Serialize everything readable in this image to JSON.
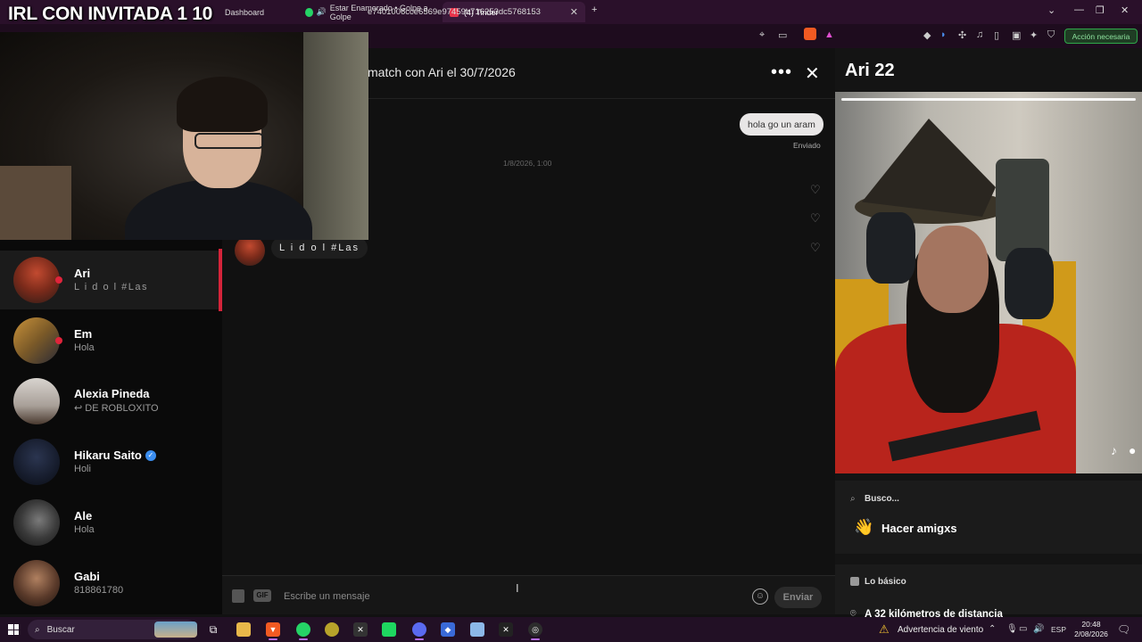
{
  "stream": {
    "title": "IRL CON INVITADA 1 10"
  },
  "browser": {
    "tabs": [
      {
        "label": "Dashboard",
        "active": false
      },
      {
        "label": "Estar Enamorado • Golpe a Golpe",
        "active": false
      },
      {
        "label": "(4) Tinder",
        "active": true
      }
    ],
    "new_tab": "+",
    "url": "e7401006cce6569e97459b716253dc5768153",
    "action_button": "Acción necesaria",
    "window_controls": [
      "⌄",
      "—",
      "❐",
      "✕"
    ]
  },
  "sidebar": {
    "matches": [
      {
        "name": "Ari",
        "message": "L i d o l #Las",
        "online": true,
        "verified": false,
        "active": true
      },
      {
        "name": "Em",
        "message": "Hola",
        "online": true,
        "verified": false,
        "active": false
      },
      {
        "name": "Alexia Pineda",
        "message": "↩ DE ROBLOXITO",
        "online": false,
        "verified": false,
        "active": false
      },
      {
        "name": "Hikaru Saito",
        "message": "Holi",
        "online": false,
        "verified": true,
        "active": false
      },
      {
        "name": "Ale",
        "message": "Hola",
        "online": false,
        "verified": false,
        "active": false
      },
      {
        "name": "Gabi",
        "message": "818861780",
        "online": false,
        "verified": false,
        "active": false
      }
    ]
  },
  "chat": {
    "header": "match con Ari el 30/7/2026",
    "more_icon": "•••",
    "close_icon": "✕",
    "sent_message": "hola go un aram",
    "sent_status": "Enviado",
    "timestamp": "1/8/2026, 1:00",
    "received_message": "L i d o l #Las",
    "gif_label": "GIF",
    "input_placeholder": "Escribe un mensaje",
    "send_label": "Enviar"
  },
  "profile": {
    "name_age": "Ari 22",
    "looking_for_label": "Busco...",
    "looking_for_value": "Hacer amigxs",
    "basics_label": "Lo básico",
    "distance": "A 32 kilómetros de distancia"
  },
  "taskbar": {
    "search_label": "Buscar",
    "weather": "Advertencia de viento",
    "language": "ESP",
    "time": "20:48",
    "date": "2/08/2026"
  },
  "colors": {
    "accent": "#d5243a",
    "background": "#111111",
    "taskbar": "#221025",
    "action_green": "#2fa84a"
  }
}
